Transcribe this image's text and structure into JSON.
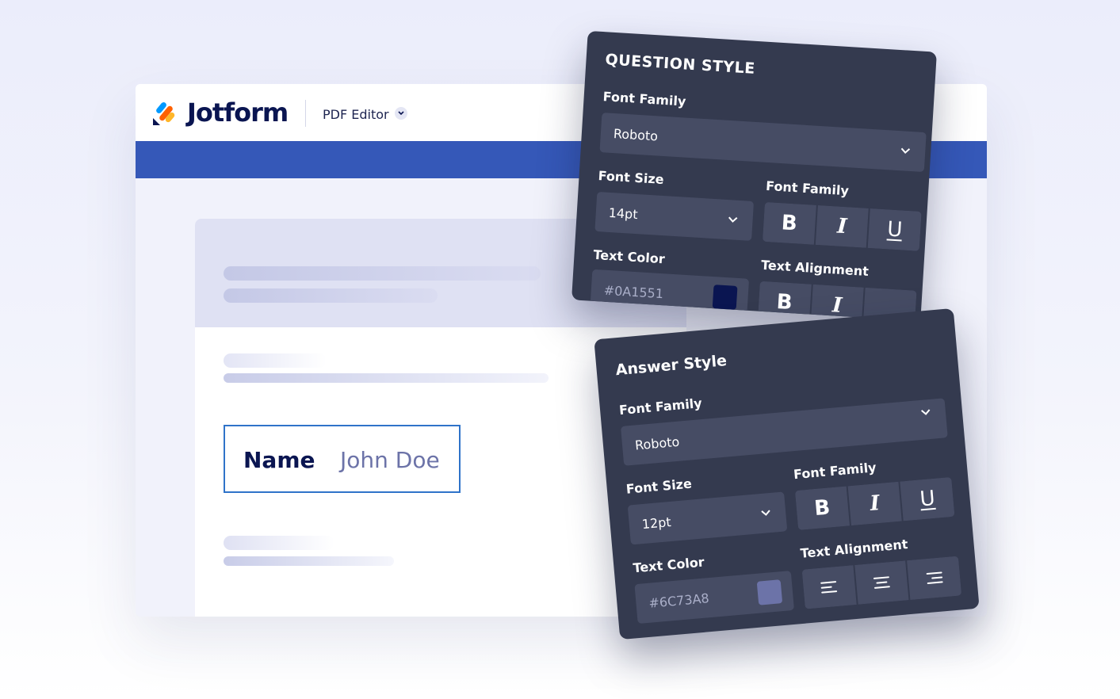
{
  "app": {
    "brand": "Jotform",
    "product": "PDF Editor"
  },
  "document": {
    "field": {
      "label": "Name",
      "value": "John Doe"
    }
  },
  "question_style": {
    "title": "QUESTION STYLE",
    "font_family_label": "Font Family",
    "font_family_value": "Roboto",
    "font_size_label": "Font Size",
    "font_size_value": "14pt",
    "style_label": "Font Family",
    "style_buttons": [
      "B",
      "I",
      "U"
    ],
    "text_color_label": "Text Color",
    "text_color_value": "#0A1551",
    "text_alignment_label": "Text Alignment",
    "alignment_buttons": [
      "B",
      "I"
    ]
  },
  "answer_style": {
    "title": "Answer Style",
    "font_family_label": "Font Family",
    "font_family_value": "Roboto",
    "font_size_label": "Font Size",
    "font_size_value": "12pt",
    "style_label": "Font Family",
    "style_buttons": [
      "B",
      "I",
      "U"
    ],
    "text_color_label": "Text Color",
    "text_color_value": "#6C73A8",
    "text_alignment_label": "Text Alignment",
    "alignment_icons": [
      "align-left-icon",
      "align-center-icon",
      "align-right-icon"
    ]
  },
  "colors": {
    "navy": "#0A1551",
    "brand_blue": "#3558B8",
    "field_border": "#2F73C9",
    "panel_bg": "#343A4F",
    "panel_field_bg": "#464C64",
    "answer_swatch": "#6C73A8"
  }
}
